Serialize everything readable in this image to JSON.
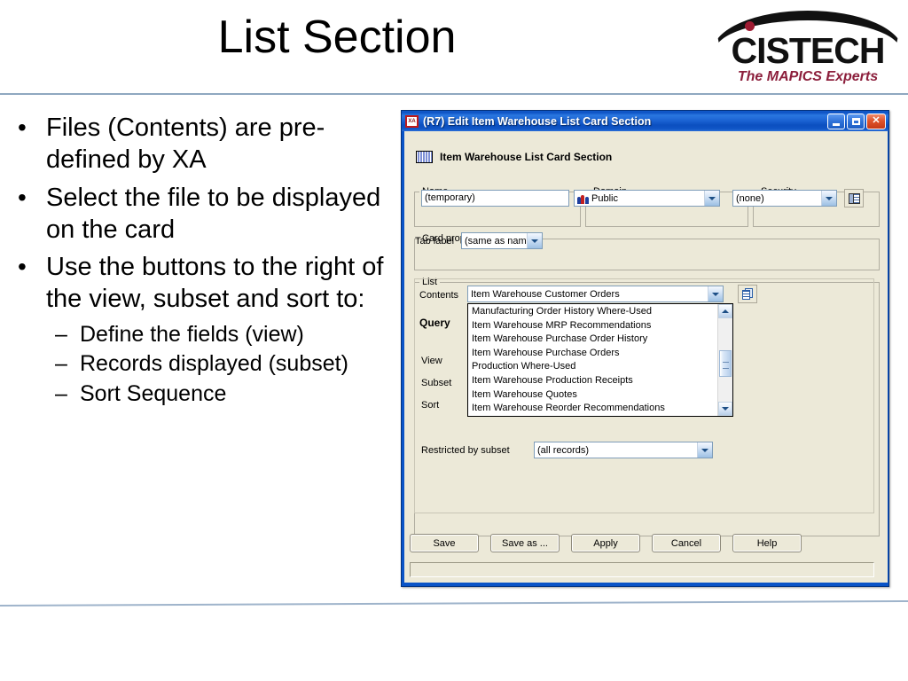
{
  "slide": {
    "title": "List Section",
    "bullets": [
      "Files (Contents) are pre-defined by XA",
      "Select the file to be displayed on the card",
      "Use the buttons to the right of the view, subset and sort to:"
    ],
    "sub_bullets": [
      "Define the fields (view)",
      "Records displayed (subset)",
      "Sort Sequence"
    ]
  },
  "logo": {
    "word": "CISTECH",
    "tagline": "The MAPICS Experts"
  },
  "dialog": {
    "title": "(R7) Edit Item Warehouse List Card Section",
    "app_icon": "XA",
    "window_buttons": {
      "minimize": "minimize-icon",
      "maximize": "maximize-icon",
      "close": "close-icon"
    },
    "section_header": "Item Warehouse List Card Section",
    "groups": {
      "name": {
        "legend": "Name",
        "value": "(temporary)"
      },
      "domain": {
        "legend": "Domain",
        "value": "Public",
        "icon": "people-icon"
      },
      "security": {
        "legend": "Security",
        "value": "(none)",
        "button_icon": "security-list-icon"
      },
      "card_properties": {
        "legend": "Card properties",
        "tab_label_label": "Tab label",
        "tab_label_value": "(same as name)"
      },
      "list": {
        "legend": "List",
        "contents_label": "Contents",
        "contents_value": "Item Warehouse Customer Orders",
        "copy_button_icon": "copy-icon",
        "dropdown_options": [
          "Manufacturing Order History Where-Used",
          "Item Warehouse MRP Recommendations",
          "Item Warehouse Purchase Order History",
          "Item Warehouse Purchase Orders",
          "Production Where-Used",
          "Item Warehouse Production Receipts",
          "Item Warehouse Quotes",
          "Item Warehouse Reorder Recommendations"
        ],
        "query_label": "Query",
        "query_items": [
          "View",
          "Subset",
          "Sort"
        ],
        "restricted_label": "Restricted by subset",
        "restricted_value": "(all records)"
      }
    },
    "buttons": [
      "Save",
      "Save as ...",
      "Apply",
      "Cancel",
      "Help"
    ],
    "status_text": ""
  },
  "colors": {
    "titlebar_blue": "#0a54c8",
    "dialog_face": "#ece9d8",
    "accent_rule": "#8fa8c0",
    "logo_maroon": "#8c1f3c"
  }
}
